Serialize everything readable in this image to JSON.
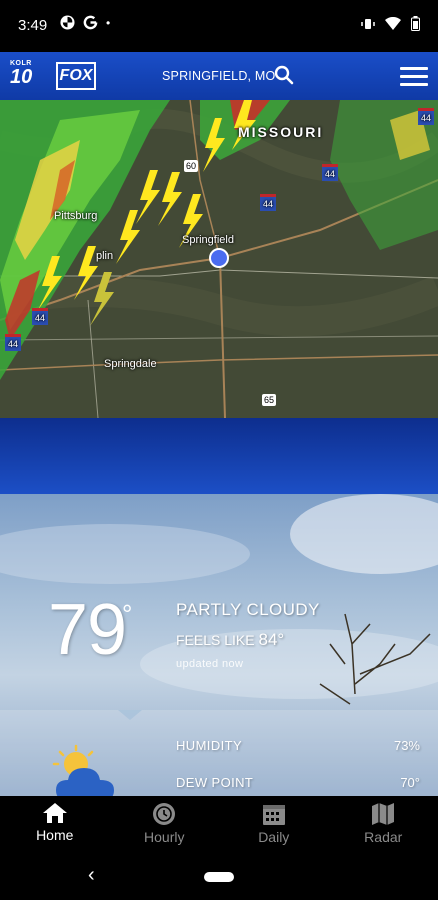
{
  "status_bar": {
    "time": "3:49",
    "dot": "•"
  },
  "header": {
    "logo_station_small": "KOLR",
    "logo_station_number": "10",
    "logo_network": "FOX",
    "location": "SPRINGFIELD, MO"
  },
  "map": {
    "labels": {
      "state": "MISSOURI",
      "city_1": "Pittsburg",
      "city_2": "Springfield",
      "city_3": "Springdale",
      "city_4": "plin"
    },
    "highways": {
      "i44_a": "44",
      "i44_b": "44",
      "i44_c": "44",
      "i44_d": "44",
      "i44_e": "44",
      "us65": "65",
      "us60": "60"
    }
  },
  "current": {
    "temperature": "79",
    "degree_symbol": "°",
    "condition": "PARTLY CLOUDY",
    "feels_like_label": "FEELS LIKE",
    "feels_like_value": "84°",
    "updated": "updated now",
    "humidity_label": "HUMIDITY",
    "humidity_value": "73%",
    "dew_point_label": "DEW POINT",
    "dew_point_value": "70°"
  },
  "tabs": [
    {
      "label": "Home",
      "icon": "home-icon",
      "active": true
    },
    {
      "label": "Hourly",
      "icon": "clock-icon",
      "active": false
    },
    {
      "label": "Daily",
      "icon": "calendar-icon",
      "active": false
    },
    {
      "label": "Radar",
      "icon": "map-icon",
      "active": false
    }
  ],
  "nav": {
    "back": "‹"
  },
  "colors": {
    "header_blue": "#1a4ec8",
    "band_blue": "#1c4fc6",
    "active_tab": "#ffffff",
    "inactive_tab": "#8a8a8a"
  }
}
